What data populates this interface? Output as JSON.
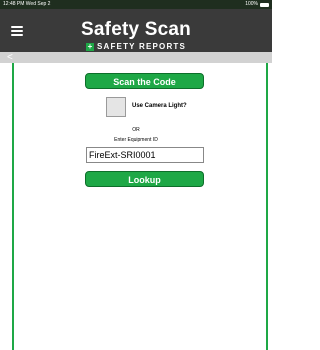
{
  "status_bar": {
    "time_date": "12:48 PM  Wed Sep 2",
    "battery": "100%"
  },
  "header": {
    "title": "Safety Scan",
    "logo_plus": "+",
    "logo_text": "SAFETY REPORTS"
  },
  "nav": {
    "back": "<"
  },
  "main": {
    "scan_button": "Scan the Code",
    "camera_light_label": "Use Camera Light?",
    "or_text": "OR",
    "equipment_label": "Enter Equipment ID",
    "equipment_value": "FireExt-SRI0001",
    "lookup_button": "Lookup"
  },
  "colors": {
    "accent": "#1ea846",
    "header_bg": "#3a3a3a",
    "subbar_bg": "#d2d2d2"
  },
  "icons": {
    "menu": "hamburger-icon",
    "back": "back-chevron-icon",
    "battery": "battery-icon"
  }
}
